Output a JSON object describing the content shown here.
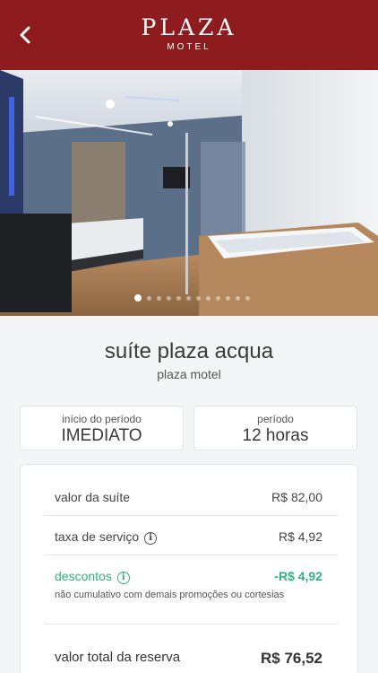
{
  "header": {
    "logo_main": "PLAZA",
    "logo_sub": "MOTEL",
    "brand_color": "#8e1b1e",
    "back_icon": "chevron-left-icon"
  },
  "carousel": {
    "total_slides": 12,
    "active_index": 0
  },
  "suite": {
    "name": "suíte plaza acqua",
    "motel": "plaza motel"
  },
  "booking": {
    "start_label": "início do período",
    "start_value": "IMEDIATO",
    "period_label": "período",
    "period_value": "12 horas"
  },
  "pricing": {
    "suite_label": "valor da suíte",
    "suite_value": "R$ 82,00",
    "service_label": "taxa de serviço",
    "service_value": "R$ 4,92",
    "discount_label": "descontos",
    "discount_value": "-R$ 4,92",
    "discount_note": "não cumulativo com demais promoções ou cortesias",
    "total_label": "valor total da reserva",
    "total_value": "R$ 76,52",
    "discount_color": "#2fb07c",
    "info_icon": "info-icon"
  }
}
